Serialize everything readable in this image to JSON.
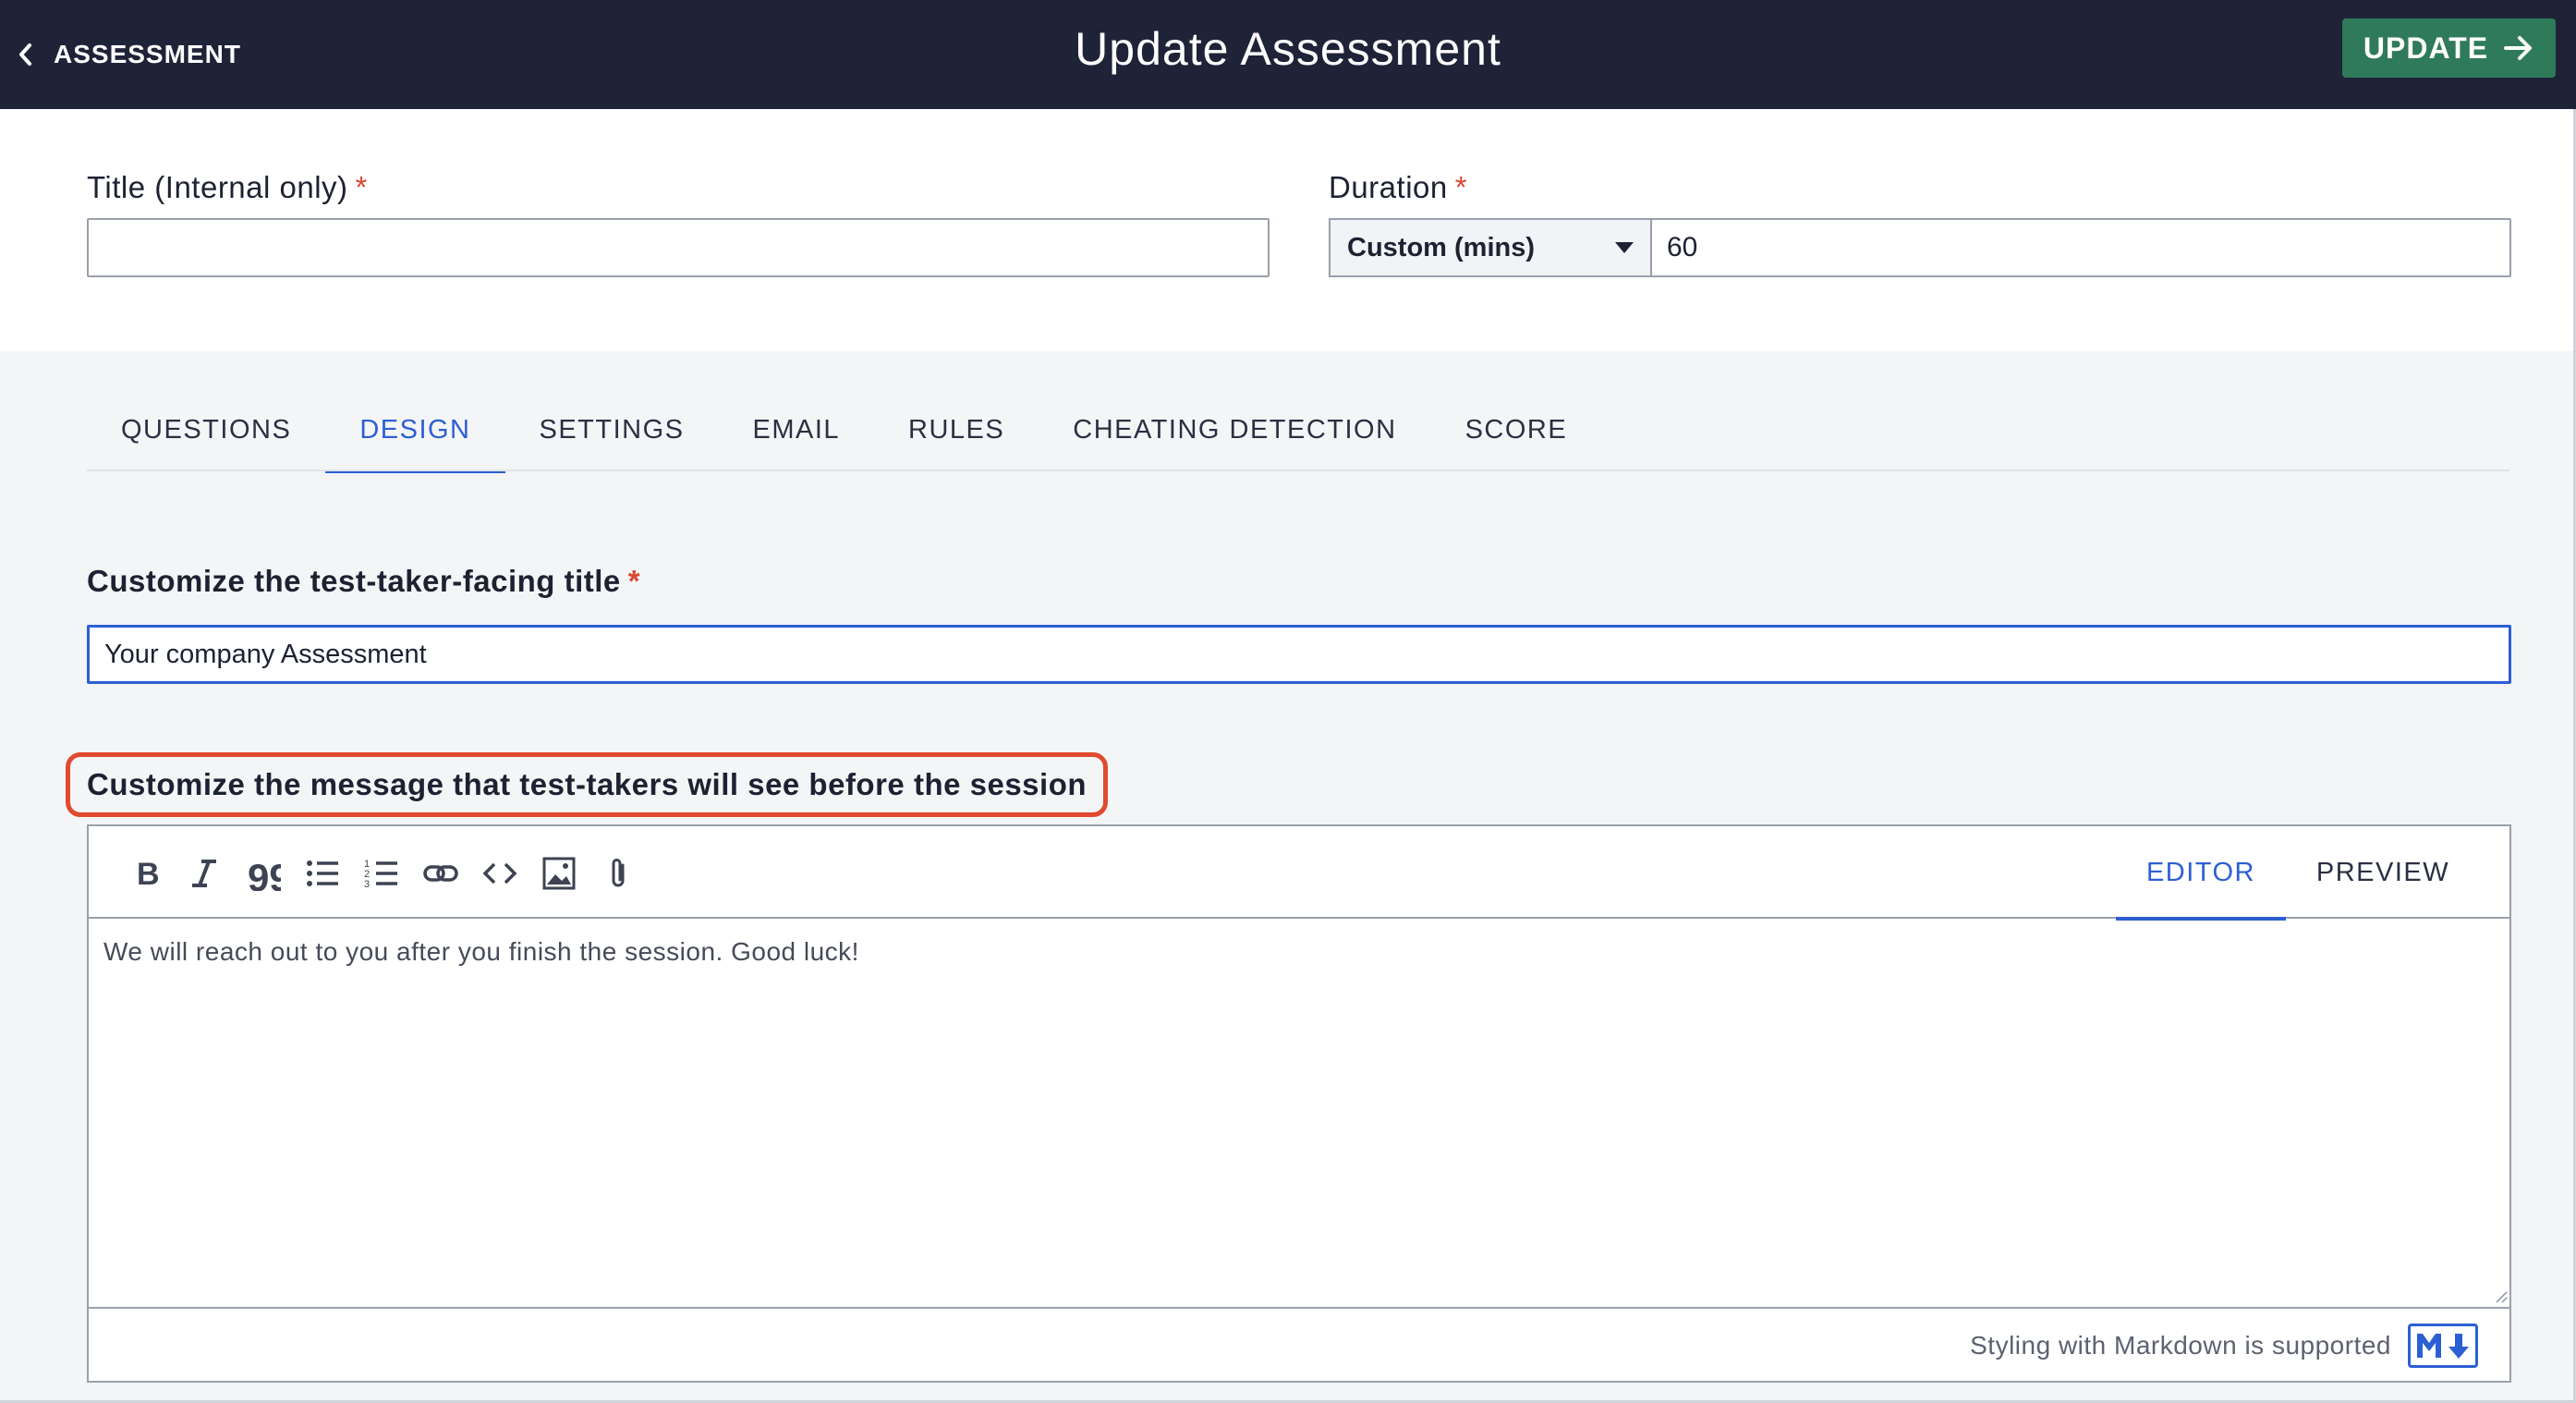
{
  "header": {
    "back_label": "ASSESSMENT",
    "title": "Update Assessment",
    "update_label": "UPDATE"
  },
  "form": {
    "title_label": "Title (Internal only)",
    "title_value": "",
    "required_mark": "*",
    "duration_label": "Duration",
    "duration_mode": "Custom (mins)",
    "duration_value": "60"
  },
  "tabs": [
    {
      "label": "QUESTIONS",
      "active": false
    },
    {
      "label": "DESIGN",
      "active": true
    },
    {
      "label": "SETTINGS",
      "active": false
    },
    {
      "label": "EMAIL",
      "active": false
    },
    {
      "label": "RULES",
      "active": false
    },
    {
      "label": "CHEATING DETECTION",
      "active": false
    },
    {
      "label": "SCORE",
      "active": false
    }
  ],
  "design": {
    "title_label": "Customize the test-taker-facing title",
    "title_value": "Your company Assessment",
    "message_label": "Customize the message that test-takers will see before the session",
    "message_text": "We will reach out to you after you finish the session. Good luck!",
    "editor_tab": "EDITOR",
    "preview_tab": "PREVIEW",
    "markdown_note": "Styling with Markdown is supported"
  },
  "toolbar_icons": [
    "bold-icon",
    "italic-icon",
    "quote-icon",
    "bullet-list-icon",
    "numbered-list-icon",
    "link-icon",
    "code-icon",
    "image-icon",
    "attachment-icon"
  ],
  "colors": {
    "header_bg": "#1e2337",
    "update_button": "#2f7a5a",
    "accent": "#2c5fd3",
    "required": "#d9472f",
    "highlight": "#e04a2f"
  }
}
